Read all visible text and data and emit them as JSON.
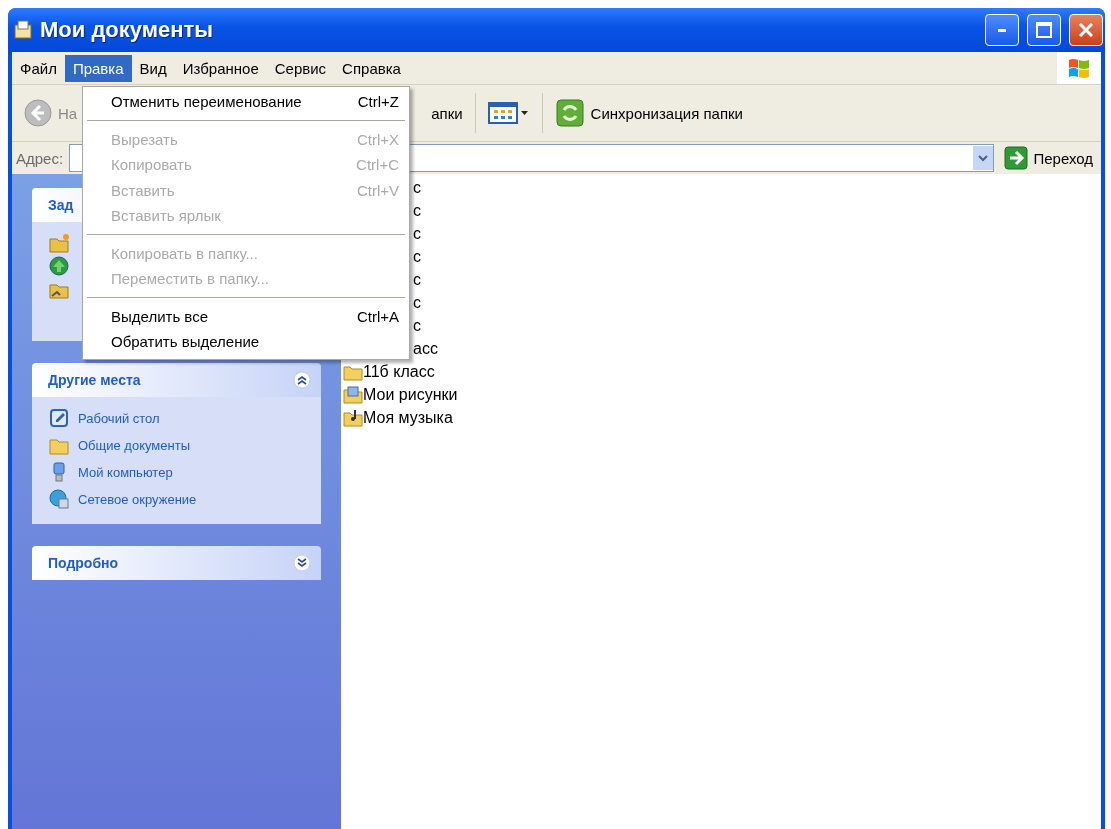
{
  "window": {
    "title": "Мои документы"
  },
  "menu_bar": [
    {
      "label": "Файл",
      "selected": false
    },
    {
      "label": "Правка",
      "selected": true
    },
    {
      "label": "Вид",
      "selected": false
    },
    {
      "label": "Избранное",
      "selected": false
    },
    {
      "label": "Сервис",
      "selected": false
    },
    {
      "label": "Справка",
      "selected": false
    }
  ],
  "toolbar": {
    "back_label": "На",
    "folders_label": "апки",
    "sync_label": "Синхронизация папки"
  },
  "address_bar": {
    "label": "Адрес:",
    "go_label": "Переход"
  },
  "open_menu": [
    {
      "kind": "item",
      "label": "Отменить переименование",
      "shortcut": "Ctrl+Z",
      "disabled": false
    },
    {
      "kind": "separator"
    },
    {
      "kind": "item",
      "label": "Вырезать",
      "shortcut": "Ctrl+X",
      "disabled": true
    },
    {
      "kind": "item",
      "label": "Копировать",
      "shortcut": "Ctrl+C",
      "disabled": true
    },
    {
      "kind": "item",
      "label": "Вставить",
      "shortcut": "Ctrl+V",
      "disabled": true
    },
    {
      "kind": "item",
      "label": "Вставить ярлык",
      "disabled": true
    },
    {
      "kind": "separator"
    },
    {
      "kind": "item",
      "label": "Копировать в папку...",
      "disabled": true
    },
    {
      "kind": "item",
      "label": "Переместить в папку...",
      "disabled": true
    },
    {
      "kind": "separator"
    },
    {
      "kind": "item",
      "label": "Выделить все",
      "shortcut": "Ctrl+A",
      "disabled": false
    },
    {
      "kind": "item",
      "label": "Обратить выделение",
      "disabled": false
    }
  ],
  "task_panels": [
    {
      "title": "Зад",
      "items": [
        {
          "kind": "new-folder"
        },
        {
          "kind": "web"
        },
        {
          "kind": "shared-folder"
        }
      ]
    },
    {
      "title": "Другие места",
      "expanded": true,
      "items": [
        {
          "kind": "desktop",
          "label": "Рабочий стол"
        },
        {
          "kind": "folder",
          "label": "Общие документы"
        },
        {
          "kind": "computer",
          "label": "Мой компьютер"
        },
        {
          "kind": "network",
          "label": "Сетевое окружение"
        }
      ]
    },
    {
      "title": "Подробно",
      "expanded": false
    }
  ],
  "files": [
    {
      "kind": "covered",
      "label": "с"
    },
    {
      "kind": "covered",
      "label": "с"
    },
    {
      "kind": "covered",
      "label": "с"
    },
    {
      "kind": "covered",
      "label": "с"
    },
    {
      "kind": "covered",
      "label": "с"
    },
    {
      "kind": "covered",
      "label": "с"
    },
    {
      "kind": "covered",
      "label": "с"
    },
    {
      "kind": "covered",
      "label": "асс"
    },
    {
      "kind": "folder",
      "label": "11б класс"
    },
    {
      "kind": "pictures",
      "label": "Мои рисунки"
    },
    {
      "kind": "music",
      "label": "Моя музыка"
    }
  ]
}
